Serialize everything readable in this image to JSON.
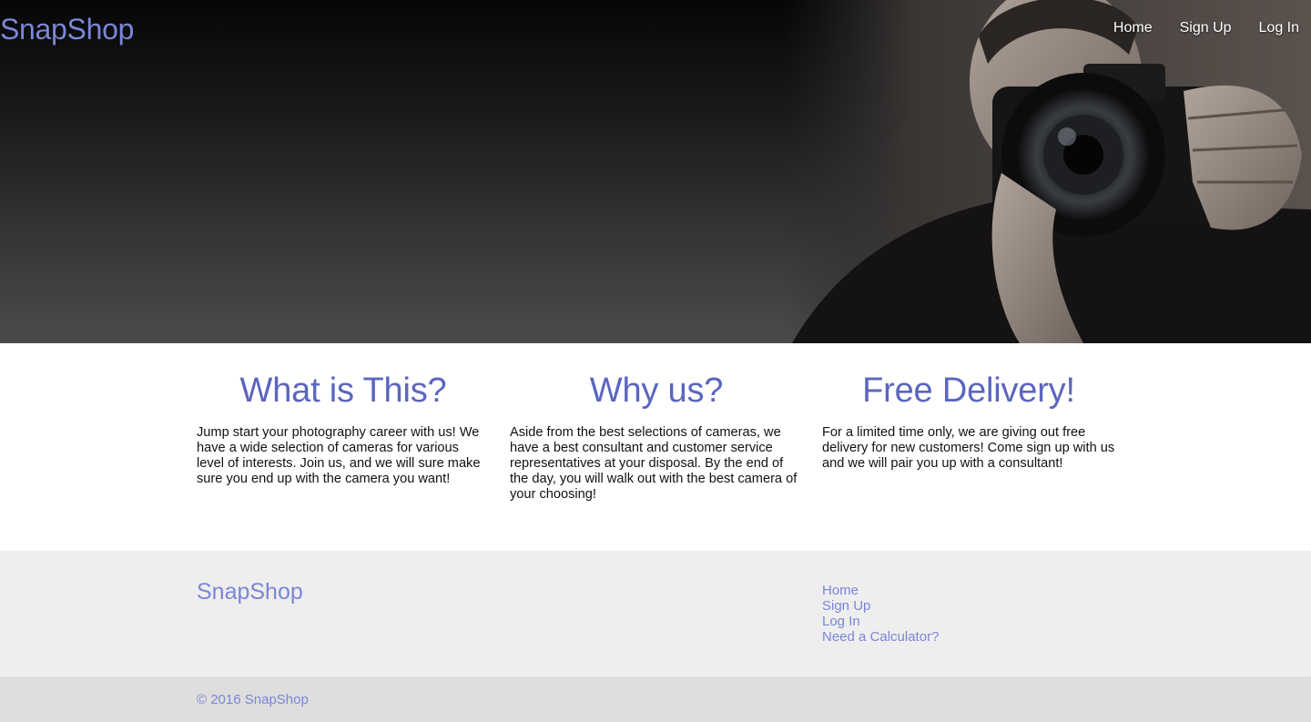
{
  "header": {
    "brand": "SnapShop",
    "nav": [
      "Home",
      "Sign Up",
      "Log In"
    ]
  },
  "hero": {
    "image": "photographer-with-camera"
  },
  "features": [
    {
      "title": "What is This?",
      "text": "Jump start your photography career with us! We have a wide selection of cameras for various level of interests. Join us, and we will sure make sure you end up with the camera you want!"
    },
    {
      "title": "Why us?",
      "text": "Aside from the best selections of cameras, we have a best consultant and customer service representatives at your disposal. By the end of the day, you will walk out with the best camera of your choosing!"
    },
    {
      "title": "Free Delivery!",
      "text": "For a limited time only, we are giving out free delivery for new customers! Come sign up with us and we will pair you up with a consultant!"
    }
  ],
  "footer": {
    "brand": "SnapShop",
    "links": [
      "Home",
      "Sign Up",
      "Log In",
      "Need a Calculator?"
    ],
    "copyright": "© 2016 SnapShop"
  },
  "colors": {
    "accent": "#7b86d6",
    "heading": "#5b66bf",
    "footer_bg": "#eeeeee",
    "copyright_bg": "#dedede"
  }
}
